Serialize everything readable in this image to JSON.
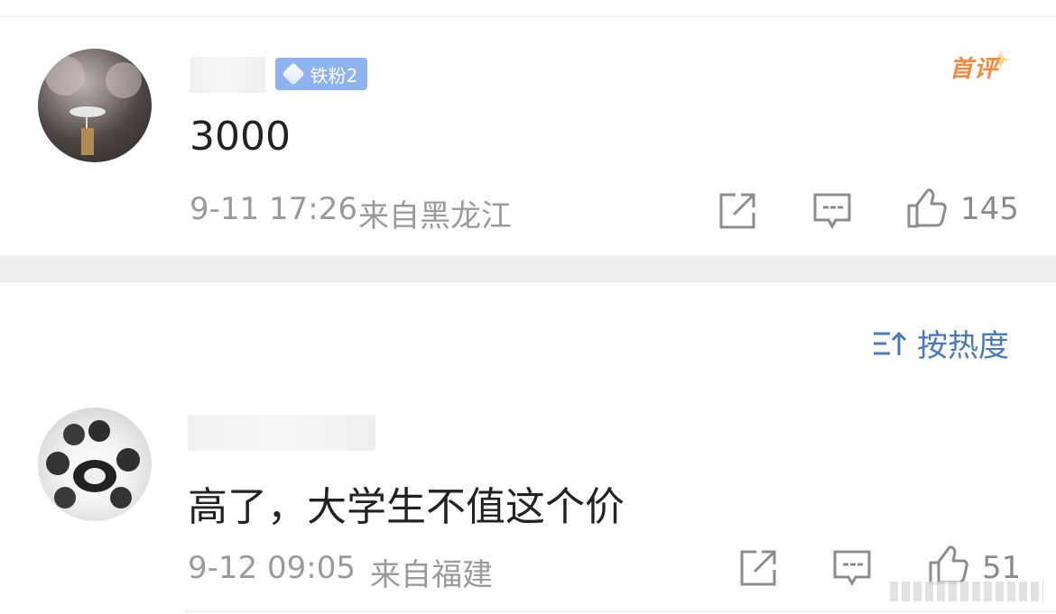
{
  "comments": [
    {
      "fan_badge": "铁粉2",
      "first_tag": "首评",
      "text": "3000",
      "time": "9-11 17:26",
      "location": "来自黑龙江",
      "likes": "145"
    },
    {
      "text": "高了，大学生不值这个价",
      "time": "9-12 09:05",
      "location": "来自福建",
      "likes": "51"
    }
  ],
  "sort": {
    "label": "按热度"
  },
  "icons": [
    "share-icon",
    "comment-icon",
    "like-icon",
    "sort-icon"
  ],
  "colors": {
    "badge": "#8fb3ee",
    "first_tag": "#f08a3c",
    "sort": "#4a7ab8",
    "meta": "#9a9a9a"
  }
}
